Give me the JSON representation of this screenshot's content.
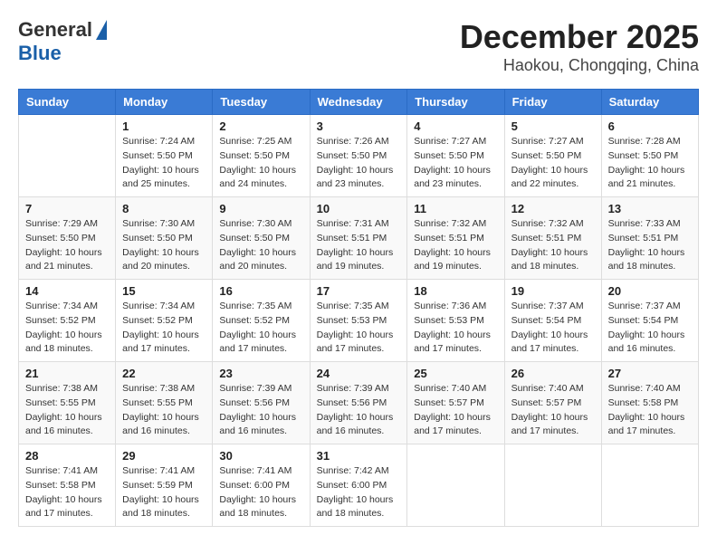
{
  "header": {
    "logo": {
      "line1": "General",
      "line2": "Blue"
    },
    "title": "December 2025",
    "location": "Haokou, Chongqing, China"
  },
  "calendar": {
    "days_of_week": [
      "Sunday",
      "Monday",
      "Tuesday",
      "Wednesday",
      "Thursday",
      "Friday",
      "Saturday"
    ],
    "weeks": [
      [
        {
          "day": "",
          "info": ""
        },
        {
          "day": "1",
          "info": "Sunrise: 7:24 AM\nSunset: 5:50 PM\nDaylight: 10 hours\nand 25 minutes."
        },
        {
          "day": "2",
          "info": "Sunrise: 7:25 AM\nSunset: 5:50 PM\nDaylight: 10 hours\nand 24 minutes."
        },
        {
          "day": "3",
          "info": "Sunrise: 7:26 AM\nSunset: 5:50 PM\nDaylight: 10 hours\nand 23 minutes."
        },
        {
          "day": "4",
          "info": "Sunrise: 7:27 AM\nSunset: 5:50 PM\nDaylight: 10 hours\nand 23 minutes."
        },
        {
          "day": "5",
          "info": "Sunrise: 7:27 AM\nSunset: 5:50 PM\nDaylight: 10 hours\nand 22 minutes."
        },
        {
          "day": "6",
          "info": "Sunrise: 7:28 AM\nSunset: 5:50 PM\nDaylight: 10 hours\nand 21 minutes."
        }
      ],
      [
        {
          "day": "7",
          "info": "Sunrise: 7:29 AM\nSunset: 5:50 PM\nDaylight: 10 hours\nand 21 minutes."
        },
        {
          "day": "8",
          "info": "Sunrise: 7:30 AM\nSunset: 5:50 PM\nDaylight: 10 hours\nand 20 minutes."
        },
        {
          "day": "9",
          "info": "Sunrise: 7:30 AM\nSunset: 5:50 PM\nDaylight: 10 hours\nand 20 minutes."
        },
        {
          "day": "10",
          "info": "Sunrise: 7:31 AM\nSunset: 5:51 PM\nDaylight: 10 hours\nand 19 minutes."
        },
        {
          "day": "11",
          "info": "Sunrise: 7:32 AM\nSunset: 5:51 PM\nDaylight: 10 hours\nand 19 minutes."
        },
        {
          "day": "12",
          "info": "Sunrise: 7:32 AM\nSunset: 5:51 PM\nDaylight: 10 hours\nand 18 minutes."
        },
        {
          "day": "13",
          "info": "Sunrise: 7:33 AM\nSunset: 5:51 PM\nDaylight: 10 hours\nand 18 minutes."
        }
      ],
      [
        {
          "day": "14",
          "info": "Sunrise: 7:34 AM\nSunset: 5:52 PM\nDaylight: 10 hours\nand 18 minutes."
        },
        {
          "day": "15",
          "info": "Sunrise: 7:34 AM\nSunset: 5:52 PM\nDaylight: 10 hours\nand 17 minutes."
        },
        {
          "day": "16",
          "info": "Sunrise: 7:35 AM\nSunset: 5:52 PM\nDaylight: 10 hours\nand 17 minutes."
        },
        {
          "day": "17",
          "info": "Sunrise: 7:35 AM\nSunset: 5:53 PM\nDaylight: 10 hours\nand 17 minutes."
        },
        {
          "day": "18",
          "info": "Sunrise: 7:36 AM\nSunset: 5:53 PM\nDaylight: 10 hours\nand 17 minutes."
        },
        {
          "day": "19",
          "info": "Sunrise: 7:37 AM\nSunset: 5:54 PM\nDaylight: 10 hours\nand 17 minutes."
        },
        {
          "day": "20",
          "info": "Sunrise: 7:37 AM\nSunset: 5:54 PM\nDaylight: 10 hours\nand 16 minutes."
        }
      ],
      [
        {
          "day": "21",
          "info": "Sunrise: 7:38 AM\nSunset: 5:55 PM\nDaylight: 10 hours\nand 16 minutes."
        },
        {
          "day": "22",
          "info": "Sunrise: 7:38 AM\nSunset: 5:55 PM\nDaylight: 10 hours\nand 16 minutes."
        },
        {
          "day": "23",
          "info": "Sunrise: 7:39 AM\nSunset: 5:56 PM\nDaylight: 10 hours\nand 16 minutes."
        },
        {
          "day": "24",
          "info": "Sunrise: 7:39 AM\nSunset: 5:56 PM\nDaylight: 10 hours\nand 16 minutes."
        },
        {
          "day": "25",
          "info": "Sunrise: 7:40 AM\nSunset: 5:57 PM\nDaylight: 10 hours\nand 17 minutes."
        },
        {
          "day": "26",
          "info": "Sunrise: 7:40 AM\nSunset: 5:57 PM\nDaylight: 10 hours\nand 17 minutes."
        },
        {
          "day": "27",
          "info": "Sunrise: 7:40 AM\nSunset: 5:58 PM\nDaylight: 10 hours\nand 17 minutes."
        }
      ],
      [
        {
          "day": "28",
          "info": "Sunrise: 7:41 AM\nSunset: 5:58 PM\nDaylight: 10 hours\nand 17 minutes."
        },
        {
          "day": "29",
          "info": "Sunrise: 7:41 AM\nSunset: 5:59 PM\nDaylight: 10 hours\nand 18 minutes."
        },
        {
          "day": "30",
          "info": "Sunrise: 7:41 AM\nSunset: 6:00 PM\nDaylight: 10 hours\nand 18 minutes."
        },
        {
          "day": "31",
          "info": "Sunrise: 7:42 AM\nSunset: 6:00 PM\nDaylight: 10 hours\nand 18 minutes."
        },
        {
          "day": "",
          "info": ""
        },
        {
          "day": "",
          "info": ""
        },
        {
          "day": "",
          "info": ""
        }
      ]
    ]
  }
}
